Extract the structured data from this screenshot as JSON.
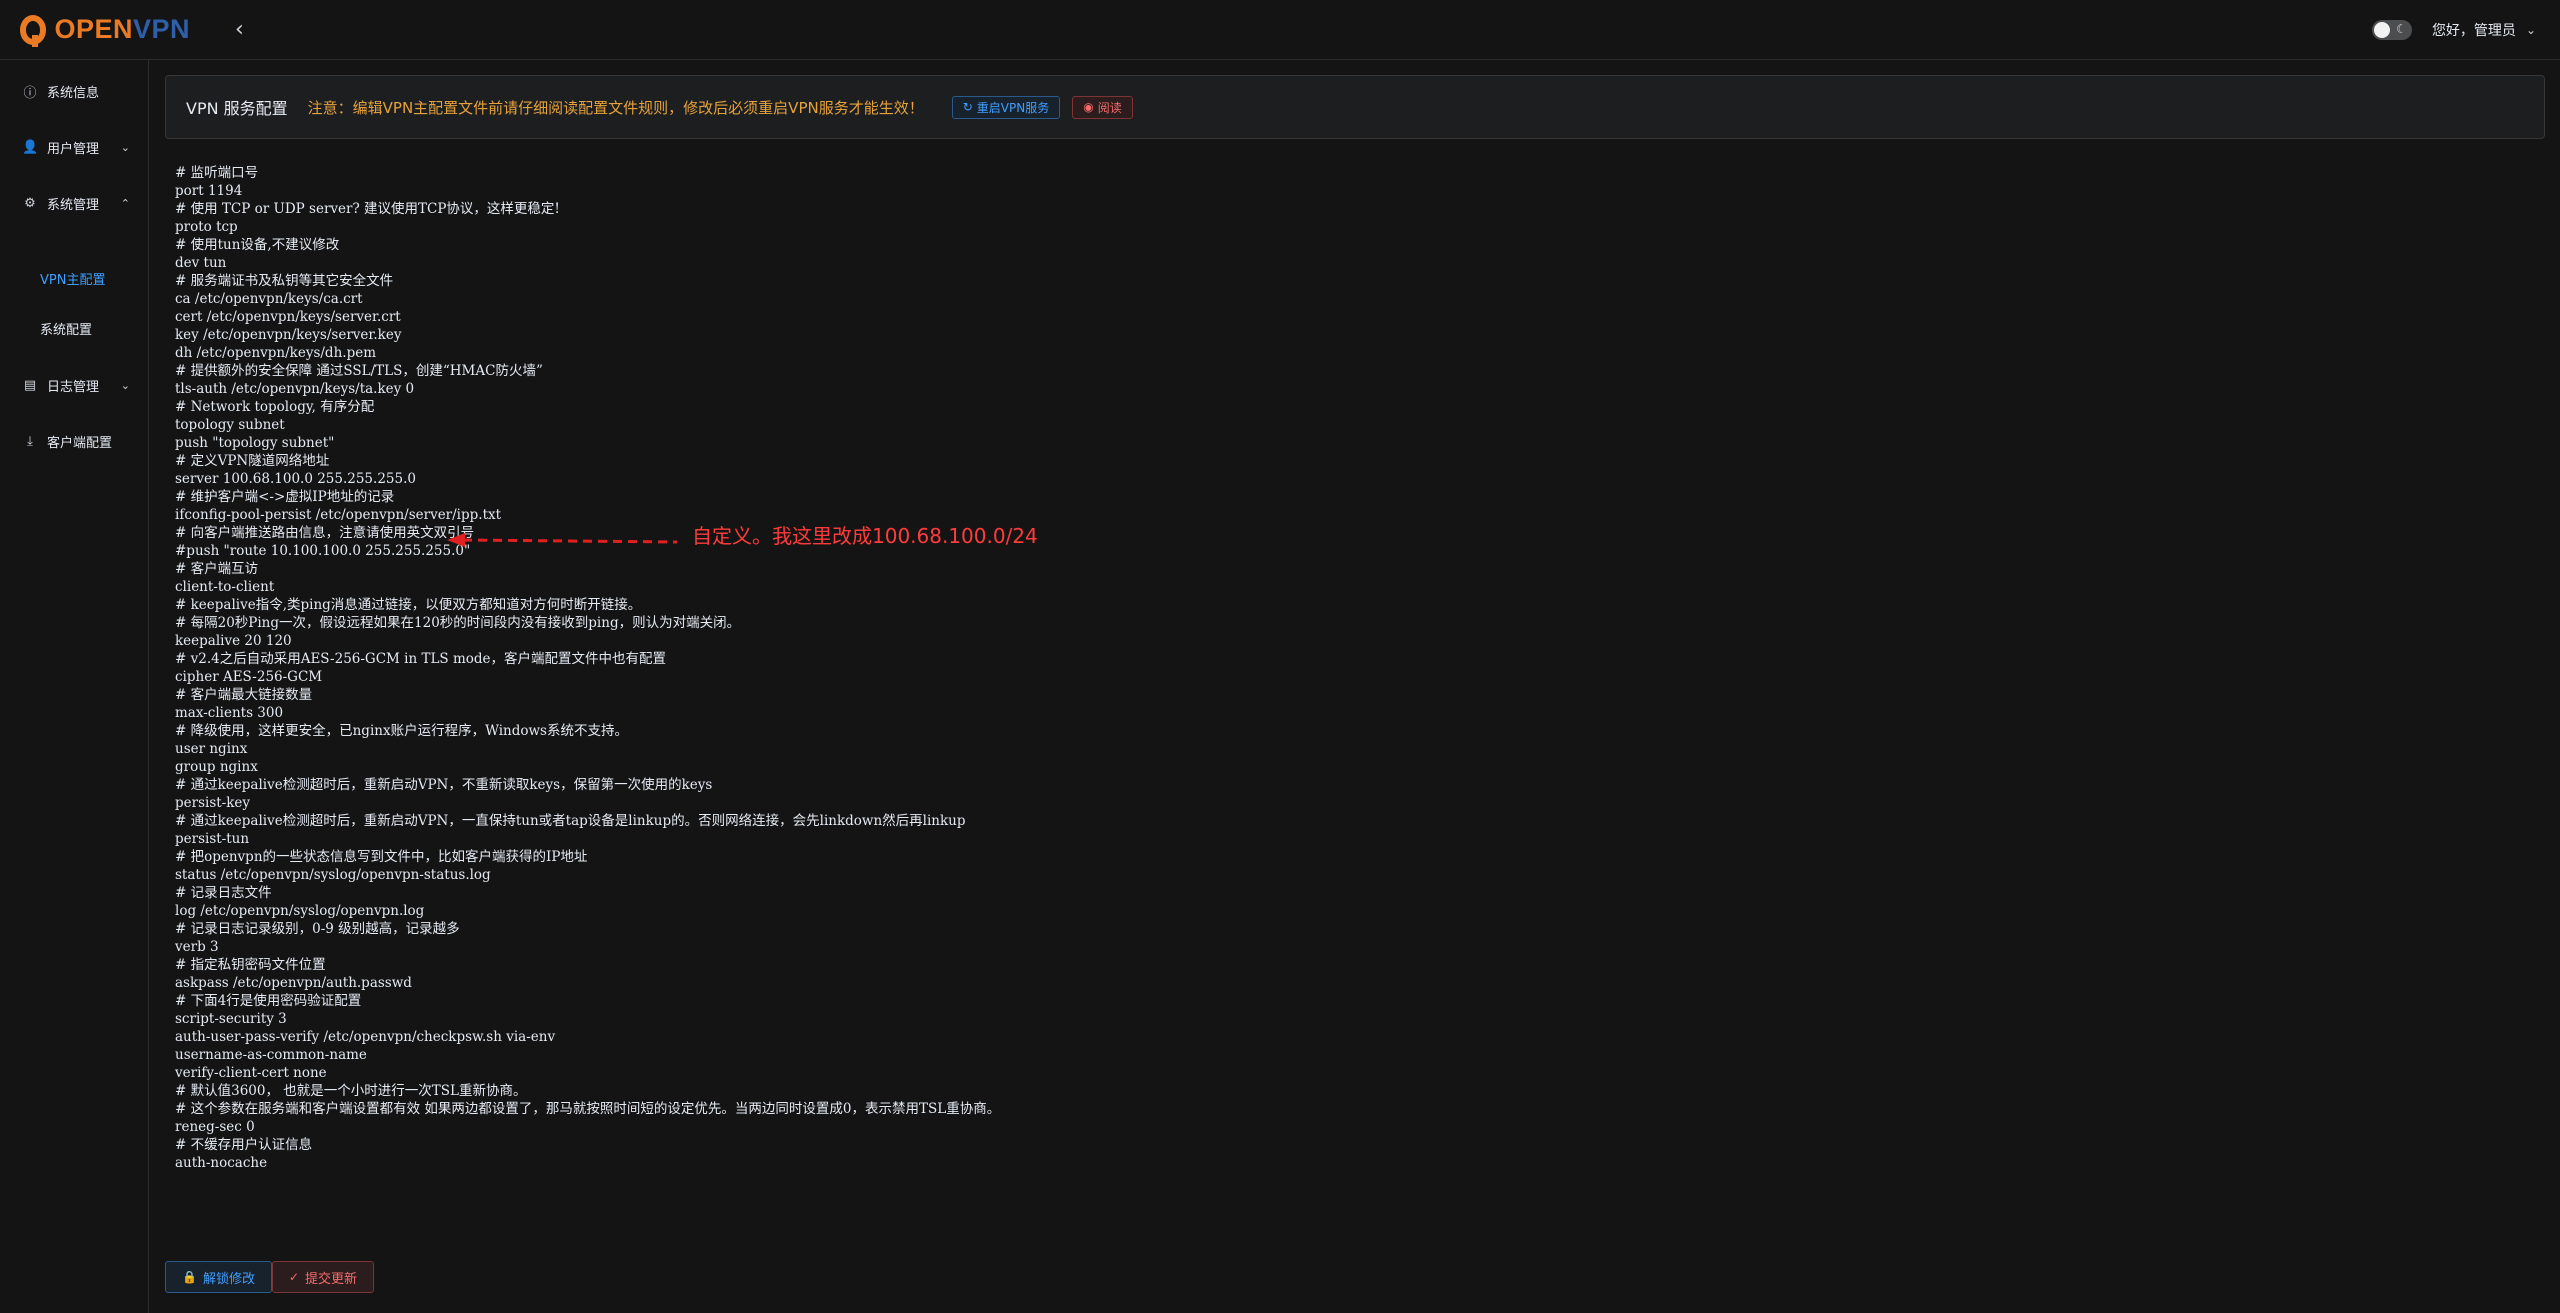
{
  "brand": {
    "open": "OPEN",
    "vpn": "VPN"
  },
  "header": {
    "greeting": "您好，管理员"
  },
  "sidebar": {
    "items": [
      {
        "label": "系统信息"
      },
      {
        "label": "用户管理"
      },
      {
        "label": "系统管理"
      },
      {
        "label": "日志管理"
      },
      {
        "label": "客户端配置"
      }
    ],
    "sub_items": [
      {
        "label": "VPN主配置"
      },
      {
        "label": "系统配置"
      }
    ]
  },
  "card": {
    "title": "VPN 服务配置",
    "notice": "注意：编辑VPN主配置文件前请仔细阅读配置文件规则，修改后必须重启VPN服务才能生效！",
    "restart_label": "重启VPN服务",
    "read_label": "阅读"
  },
  "config_lines": [
    "# 监听端口号",
    "port 1194",
    "# 使用 TCP or UDP server? 建议使用TCP协议，这样更稳定!",
    "proto tcp",
    "# 使用tun设备,不建议修改",
    "dev tun",
    "# 服务端证书及私钥等其它安全文件",
    "ca /etc/openvpn/keys/ca.crt",
    "cert /etc/openvpn/keys/server.crt",
    "key /etc/openvpn/keys/server.key",
    "dh /etc/openvpn/keys/dh.pem",
    "# 提供额外的安全保障 通过SSL/TLS，创建“HMAC防火墙”",
    "tls-auth /etc/openvpn/keys/ta.key 0",
    "# Network topology, 有序分配",
    "topology subnet",
    "push \"topology subnet\"",
    "# 定义VPN隧道网络地址",
    "server 100.68.100.0 255.255.255.0",
    "# 维护客户端<->虚拟IP地址的记录",
    "ifconfig-pool-persist /etc/openvpn/server/ipp.txt",
    "# 向客户端推送路由信息，注意请使用英文双引号",
    "#push \"route 10.100.100.0 255.255.255.0\"",
    "# 客户端互访",
    "client-to-client",
    "# keepalive指令,类ping消息通过链接，以便双方都知道对方何时断开链接。",
    "# 每隔20秒Ping一次，假设远程如果在120秒的时间段内没有接收到ping，则认为对端关闭。",
    "keepalive 20 120",
    "# v2.4之后自动采用AES-256-GCM in TLS mode，客户端配置文件中也有配置",
    "cipher AES-256-GCM",
    "# 客户端最大链接数量",
    "max-clients 300",
    "# 降级使用，这样更安全，已nginx账户运行程序，Windows系统不支持。",
    "user nginx",
    "group nginx",
    "# 通过keepalive检测超时后，重新启动VPN，不重新读取keys，保留第一次使用的keys",
    "persist-key",
    "# 通过keepalive检测超时后，重新启动VPN，一直保持tun或者tap设备是linkup的。否则网络连接，会先linkdown然后再linkup",
    "persist-tun",
    "# 把openvpn的一些状态信息写到文件中，比如客户端获得的IP地址",
    "status /etc/openvpn/syslog/openvpn-status.log",
    "# 记录日志文件",
    "log /etc/openvpn/syslog/openvpn.log",
    "# 记录日志记录级别，0-9 级别越高，记录越多",
    "verb 3",
    "# 指定私钥密码文件位置",
    "askpass /etc/openvpn/auth.passwd",
    "# 下面4行是使用密码验证配置",
    "script-security 3",
    "auth-user-pass-verify /etc/openvpn/checkpsw.sh via-env",
    "username-as-common-name",
    "verify-client-cert none",
    "# 默认值3600， 也就是一个小时进行一次TSL重新协商。",
    "# 这个参数在服务端和客户端设置都有效 如果两边都设置了，那马就按照时间短的设定优先。当两边同时设置成0，表示禁用TSL重协商。",
    "reneg-sec 0",
    "# 不缓存用户认证信息",
    "auth-nocache"
  ],
  "annotation": {
    "text": "自定义。我这里改成100.68.100.0/24",
    "color": "#ff3b3b"
  },
  "bottom": {
    "unlock_label": "解锁修改",
    "submit_label": "提交更新"
  },
  "colors": {
    "accent": "#409eff",
    "warning": "#e6a23c",
    "danger": "#f56c6c",
    "brand_orange": "#ea7a24",
    "brand_blue": "#2e5fa8"
  }
}
